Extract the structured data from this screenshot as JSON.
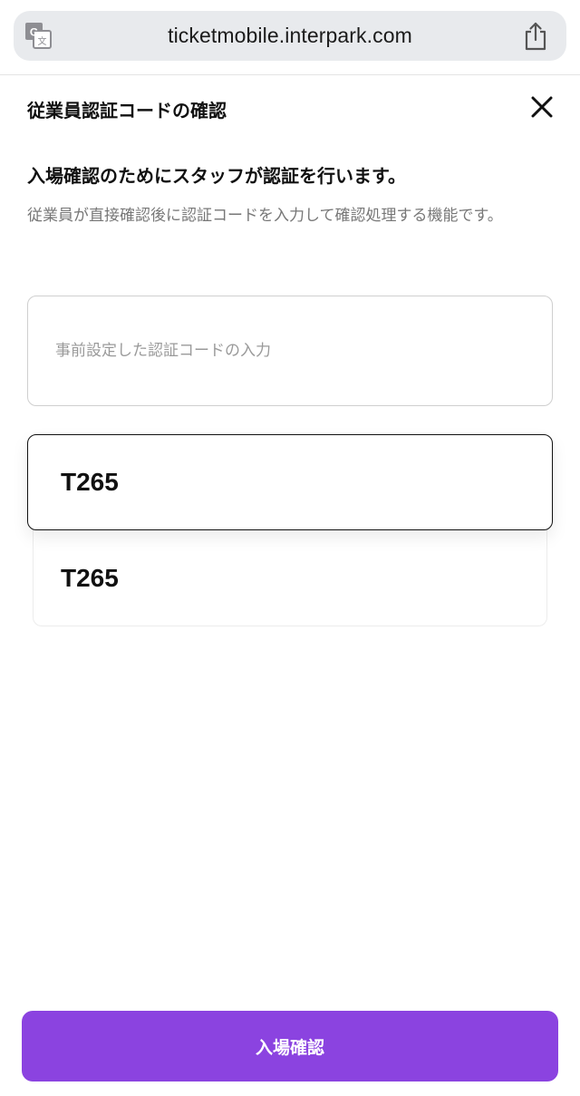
{
  "browser": {
    "url": "ticketmobile.interpark.com",
    "translate_icon": "translate-icon",
    "share_icon": "share-icon"
  },
  "header": {
    "title": "従業員認証コードの確認",
    "close_icon": "close-icon"
  },
  "intro": {
    "heading": "入場確認のためにスタッフが認証を行います。",
    "description": "従業員が直接確認後に認証コードを入力して確認処理する機能です。"
  },
  "code_input": {
    "value": "",
    "placeholder": "事前設定した認証コードの入力"
  },
  "suggestions": [
    {
      "label": "T265"
    },
    {
      "label": "T265"
    }
  ],
  "submit": {
    "label": "入場確認"
  },
  "colors": {
    "accent": "#8b43e0",
    "url_bar": "#e8eaed"
  }
}
